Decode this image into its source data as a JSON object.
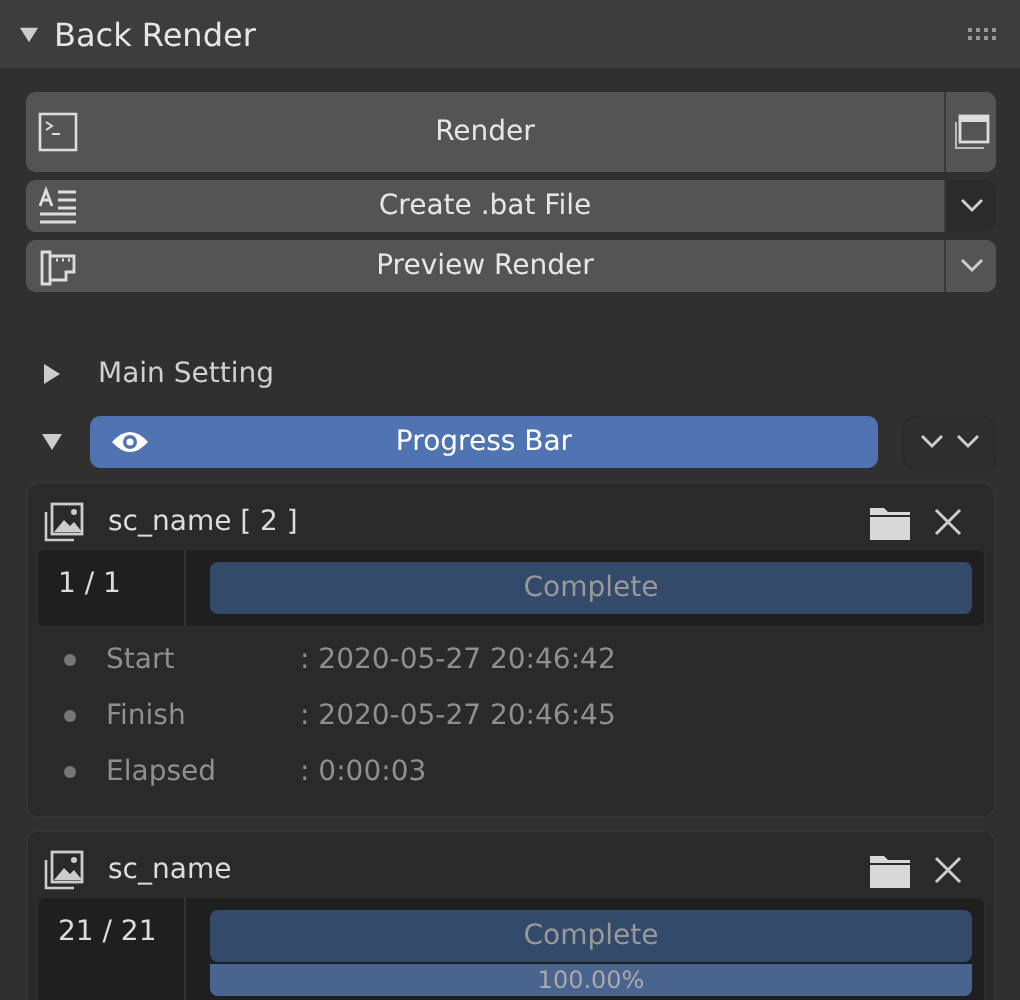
{
  "panel": {
    "title": "Back Render",
    "expanded": true
  },
  "buttons": [
    {
      "kind": "render",
      "label": "Render"
    },
    {
      "kind": "menu",
      "label": "Create .bat File",
      "menu_selected": true
    },
    {
      "kind": "menu",
      "label": "Preview Render",
      "menu_selected": false
    }
  ],
  "sections": [
    {
      "kind": "plain",
      "label": "Main Setting",
      "expanded": false
    },
    {
      "kind": "button",
      "label": "Progress Bar",
      "expanded": true
    }
  ],
  "jobs": [
    {
      "name": "sc_name [ 2 ]",
      "count": "1 / 1",
      "status": "Complete",
      "info": [
        {
          "label": "Start",
          "value": ": 2020-05-27 20:46:42"
        },
        {
          "label": "Finish",
          "value": ": 2020-05-27 20:46:45"
        },
        {
          "label": "Elapsed",
          "value": ": 0:00:03"
        }
      ]
    },
    {
      "name": "sc_name",
      "count": "21 / 21",
      "status": "Complete",
      "progress": {
        "level": 1,
        "reading": "100.00%"
      }
    }
  ]
}
